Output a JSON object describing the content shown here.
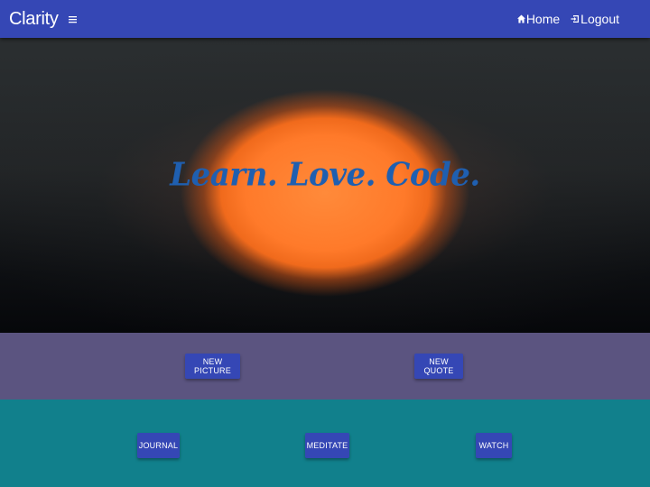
{
  "navbar": {
    "brand": "Clarity",
    "menu_icon": "hamburger-icon",
    "links": [
      {
        "label": "Home",
        "icon": "home-icon"
      },
      {
        "label": "Logout",
        "icon": "logout-icon"
      }
    ]
  },
  "hero": {
    "tagline": "Learn. Love. Code."
  },
  "actions_top": {
    "new_picture_label": "NEW PICTURE",
    "new_quote_label": "NEW QUOTE"
  },
  "actions_bottom": {
    "journal_label": "JOURNAL",
    "meditate_label": "MEDITATE",
    "watch_label": "WATCH"
  },
  "colors": {
    "navbar": "#3547b5",
    "button": "#3547b5",
    "band_purple": "#5b5480",
    "band_teal": "#11808c",
    "tagline": "#1f5fb0",
    "sun": "#ff7a2a"
  }
}
